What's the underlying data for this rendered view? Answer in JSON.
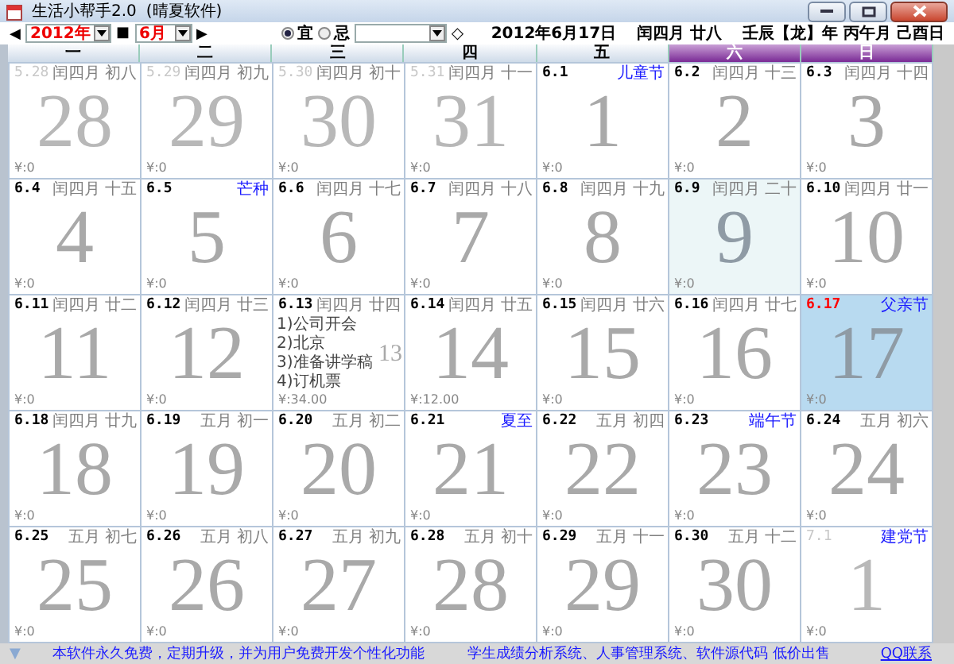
{
  "window": {
    "title": "生活小帮手2.0",
    "subtitle": "(晴夏软件)"
  },
  "toolbar": {
    "prev": "◀",
    "year": "2012年",
    "separator": "■",
    "month": "6月",
    "next": "▶",
    "filter": [
      {
        "label": "宜",
        "selected": true
      },
      {
        "label": "忌",
        "selected": false
      }
    ],
    "marker": "◇",
    "date": "2012年6月17日",
    "lunar": "闰四月 廿八",
    "ganzhi": "壬辰【龙】年 丙午月 己酉日"
  },
  "weekdays": [
    {
      "label": "一",
      "weekend": false
    },
    {
      "label": "二",
      "weekend": false
    },
    {
      "label": "三",
      "weekend": false
    },
    {
      "label": "四",
      "weekend": false
    },
    {
      "label": "五",
      "weekend": false
    },
    {
      "label": "六",
      "weekend": true
    },
    {
      "label": "日",
      "weekend": true
    }
  ],
  "weeks": [
    {
      "days": [
        {
          "date": "5.28",
          "lunar": "闰四月 初八",
          "big": "28",
          "money": "¥:0",
          "in_month": false,
          "selected": false,
          "highlighted": false
        },
        {
          "date": "5.29",
          "lunar": "闰四月 初九",
          "big": "29",
          "money": "¥:0",
          "in_month": false,
          "selected": false,
          "highlighted": false
        },
        {
          "date": "5.30",
          "lunar": "闰四月 初十",
          "big": "30",
          "money": "¥:0",
          "in_month": false,
          "selected": false,
          "highlighted": false
        },
        {
          "date": "5.31",
          "lunar": "闰四月 十一",
          "big": "31",
          "money": "¥:0",
          "in_month": false,
          "selected": false,
          "highlighted": false
        },
        {
          "date": "6.1",
          "festival": "儿童节",
          "big": "1",
          "money": "¥:0",
          "in_month": true,
          "selected": false,
          "highlighted": false
        },
        {
          "date": "6.2",
          "lunar": "闰四月 十三",
          "big": "2",
          "money": "¥:0",
          "in_month": true,
          "selected": false,
          "highlighted": false
        },
        {
          "date": "6.3",
          "lunar": "闰四月 十四",
          "big": "3",
          "money": "¥:0",
          "in_month": true,
          "selected": false,
          "highlighted": false
        }
      ]
    },
    {
      "days": [
        {
          "date": "6.4",
          "lunar": "闰四月 十五",
          "big": "4",
          "money": "¥:0",
          "in_month": true,
          "selected": false,
          "highlighted": false
        },
        {
          "date": "6.5",
          "festival": "芒种",
          "big": "5",
          "money": "¥:0",
          "in_month": true,
          "selected": false,
          "highlighted": false
        },
        {
          "date": "6.6",
          "lunar": "闰四月 十七",
          "big": "6",
          "money": "¥:0",
          "in_month": true,
          "selected": false,
          "highlighted": false
        },
        {
          "date": "6.7",
          "lunar": "闰四月 十八",
          "big": "7",
          "money": "¥:0",
          "in_month": true,
          "selected": false,
          "highlighted": false
        },
        {
          "date": "6.8",
          "lunar": "闰四月 十九",
          "big": "8",
          "money": "¥:0",
          "in_month": true,
          "selected": false,
          "highlighted": false
        },
        {
          "date": "6.9",
          "lunar": "闰四月 二十",
          "big": "9",
          "money": "¥:0",
          "in_month": true,
          "selected": false,
          "highlighted": true
        },
        {
          "date": "6.10",
          "lunar": "闰四月 廿一",
          "big": "10",
          "money": "¥:0",
          "in_month": true,
          "selected": false,
          "highlighted": false
        }
      ]
    },
    {
      "days": [
        {
          "date": "6.11",
          "lunar": "闰四月 廿二",
          "big": "11",
          "money": "¥:0",
          "in_month": true,
          "selected": false,
          "highlighted": false
        },
        {
          "date": "6.12",
          "lunar": "闰四月 廿三",
          "big": "12",
          "money": "¥:0",
          "in_month": true,
          "selected": false,
          "highlighted": false
        },
        {
          "date": "6.13",
          "lunar": "闰四月 廿四",
          "big": "13",
          "memos": [
            "1)公司开会",
            "2)北京",
            "3)准备讲学稿",
            "4)订机票"
          ],
          "money": "¥:34.00",
          "in_month": true,
          "selected": false,
          "highlighted": false
        },
        {
          "date": "6.14",
          "lunar": "闰四月 廿五",
          "big": "14",
          "money": "¥:12.00",
          "in_month": true,
          "selected": false,
          "highlighted": false
        },
        {
          "date": "6.15",
          "lunar": "闰四月 廿六",
          "big": "15",
          "money": "¥:0",
          "in_month": true,
          "selected": false,
          "highlighted": false
        },
        {
          "date": "6.16",
          "lunar": "闰四月 廿七",
          "big": "16",
          "money": "¥:0",
          "in_month": true,
          "selected": false,
          "highlighted": false
        },
        {
          "date": "6.17",
          "festival": "父亲节",
          "big": "17",
          "money": "¥:0",
          "in_month": true,
          "selected": true,
          "highlighted": false
        }
      ]
    },
    {
      "days": [
        {
          "date": "6.18",
          "lunar": "闰四月 廿九",
          "big": "18",
          "money": "¥:0",
          "in_month": true,
          "selected": false,
          "highlighted": false
        },
        {
          "date": "6.19",
          "lunar": "五月 初一",
          "big": "19",
          "money": "¥:0",
          "in_month": true,
          "selected": false,
          "highlighted": false
        },
        {
          "date": "6.20",
          "lunar": "五月 初二",
          "big": "20",
          "money": "¥:0",
          "in_month": true,
          "selected": false,
          "highlighted": false
        },
        {
          "date": "6.21",
          "festival": "夏至",
          "big": "21",
          "money": "¥:0",
          "in_month": true,
          "selected": false,
          "highlighted": false
        },
        {
          "date": "6.22",
          "lunar": "五月 初四",
          "big": "22",
          "money": "¥:0",
          "in_month": true,
          "selected": false,
          "highlighted": false
        },
        {
          "date": "6.23",
          "festival": "端午节",
          "big": "23",
          "money": "¥:0",
          "in_month": true,
          "selected": false,
          "highlighted": false
        },
        {
          "date": "6.24",
          "lunar": "五月 初六",
          "big": "24",
          "money": "¥:0",
          "in_month": true,
          "selected": false,
          "highlighted": false
        }
      ]
    },
    {
      "days": [
        {
          "date": "6.25",
          "lunar": "五月 初七",
          "big": "25",
          "money": "¥:0",
          "in_month": true,
          "selected": false,
          "highlighted": false
        },
        {
          "date": "6.26",
          "lunar": "五月 初八",
          "big": "26",
          "money": "¥:0",
          "in_month": true,
          "selected": false,
          "highlighted": false
        },
        {
          "date": "6.27",
          "lunar": "五月 初九",
          "big": "27",
          "money": "¥:0",
          "in_month": true,
          "selected": false,
          "highlighted": false
        },
        {
          "date": "6.28",
          "lunar": "五月 初十",
          "big": "28",
          "money": "¥:0",
          "in_month": true,
          "selected": false,
          "highlighted": false
        },
        {
          "date": "6.29",
          "lunar": "五月 十一",
          "big": "29",
          "money": "¥:0",
          "in_month": true,
          "selected": false,
          "highlighted": false
        },
        {
          "date": "6.30",
          "lunar": "五月 十二",
          "big": "30",
          "money": "¥:0",
          "in_month": true,
          "selected": false,
          "highlighted": false
        },
        {
          "date": "7.1",
          "festival": "建党节",
          "big": "1",
          "money": "¥:0",
          "in_month": false,
          "selected": false,
          "highlighted": false
        }
      ]
    }
  ],
  "status": {
    "icon": "▼",
    "notice": "本软件永久免费，定期升级，并为用户免费开发个性化功能",
    "ad": "学生成绩分析系统、人事管理系统、软件源代码 低价出售",
    "contact": "QQ联系"
  }
}
